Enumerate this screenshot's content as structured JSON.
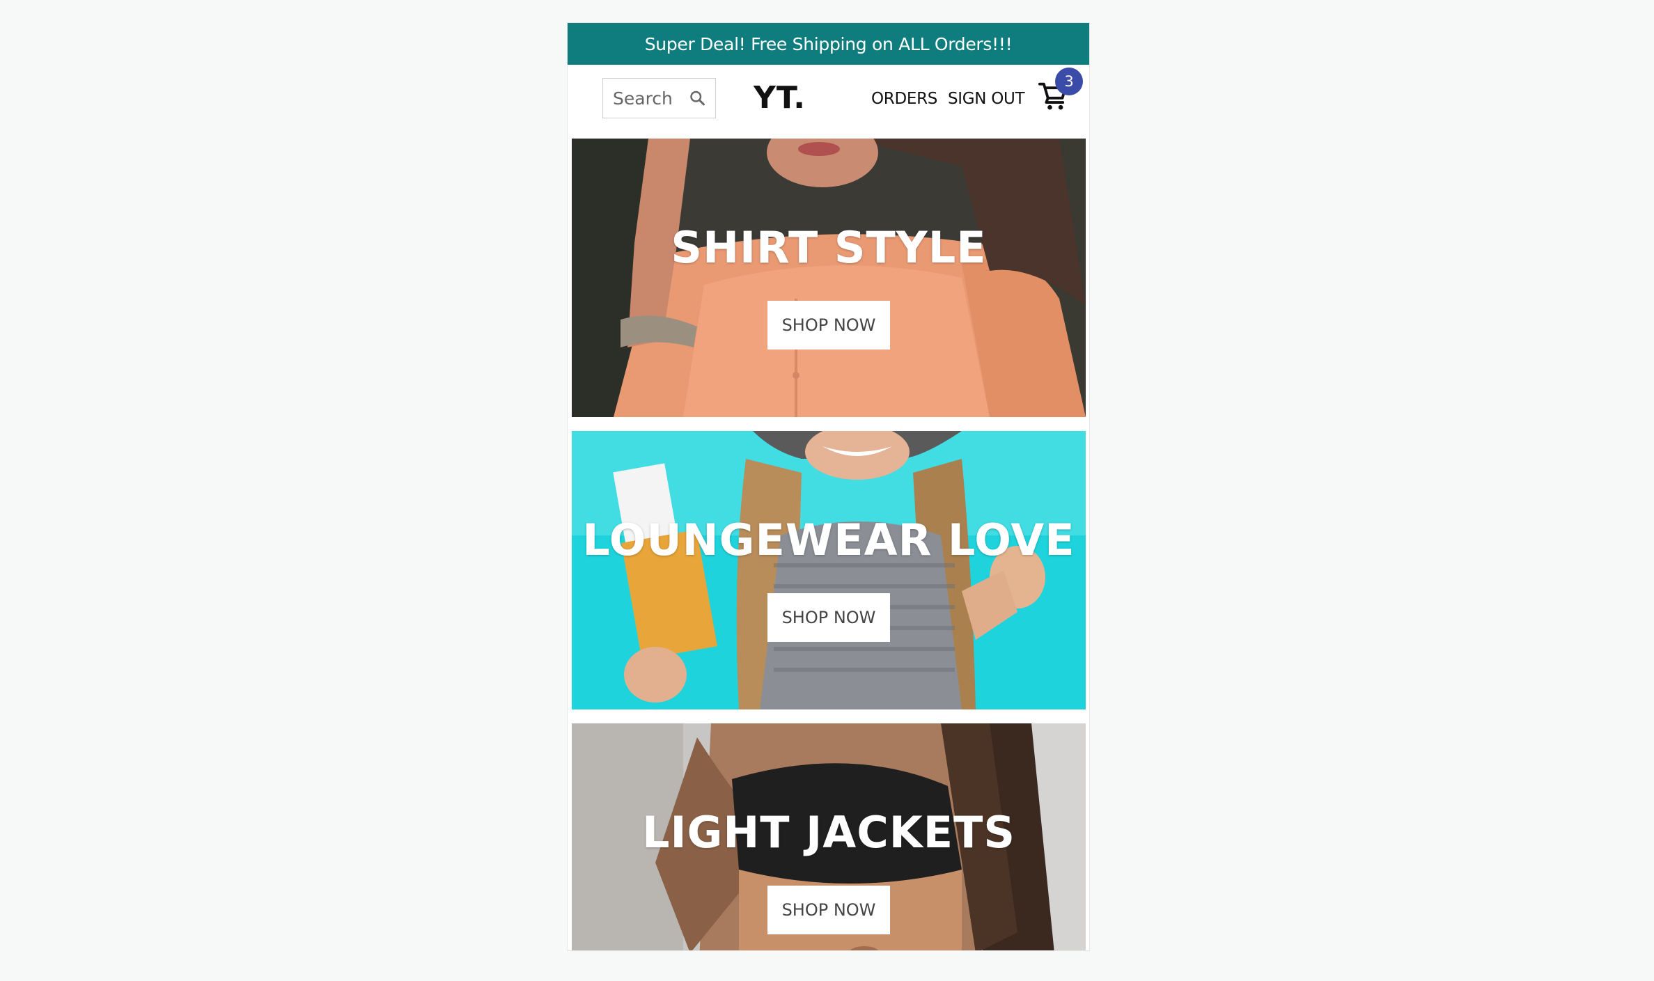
{
  "promo": {
    "text": "Super Deal! Free Shipping on ALL Orders!!!"
  },
  "header": {
    "search_placeholder": "Search",
    "logo": "YT.",
    "orders_label": "ORDERS",
    "signout_label": "SIGN OUT",
    "cart_count": "3"
  },
  "colors": {
    "promo_background": "#0f7d7e",
    "cart_badge": "#3b4ba8",
    "hero2_background": "#1fd3dc"
  },
  "icons": [
    "search-icon",
    "cart-icon"
  ],
  "heroes": [
    {
      "title": "SHIRT STYLE",
      "button": "SHOP NOW"
    },
    {
      "title": "LOUNGEWEAR LOVE",
      "button": "SHOP NOW"
    },
    {
      "title": "LIGHT JACKETS",
      "button": "SHOP NOW"
    }
  ]
}
